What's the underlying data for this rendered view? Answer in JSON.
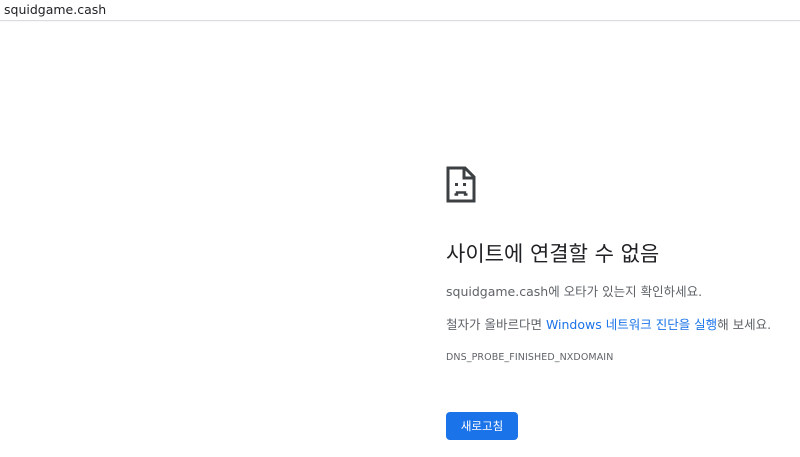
{
  "address_bar": {
    "url": "squidgame.cash"
  },
  "error_page": {
    "icon": "sad-page-icon",
    "title": "사이트에 연결할 수 없음",
    "domain": "squidgame.cash",
    "domain_suffix": "에 오타가 있는지 확인하세요.",
    "suggestion_prefix": "철자가 올바르다면 ",
    "suggestion_link": "Windows 네트워크 진단을 실행",
    "suggestion_suffix": "해 보세요.",
    "error_code": "DNS_PROBE_FINISHED_NXDOMAIN",
    "reload_label": "새로고침"
  },
  "colors": {
    "accent": "#1a73e8",
    "title": "#202124",
    "secondary_text": "#5f6368"
  }
}
